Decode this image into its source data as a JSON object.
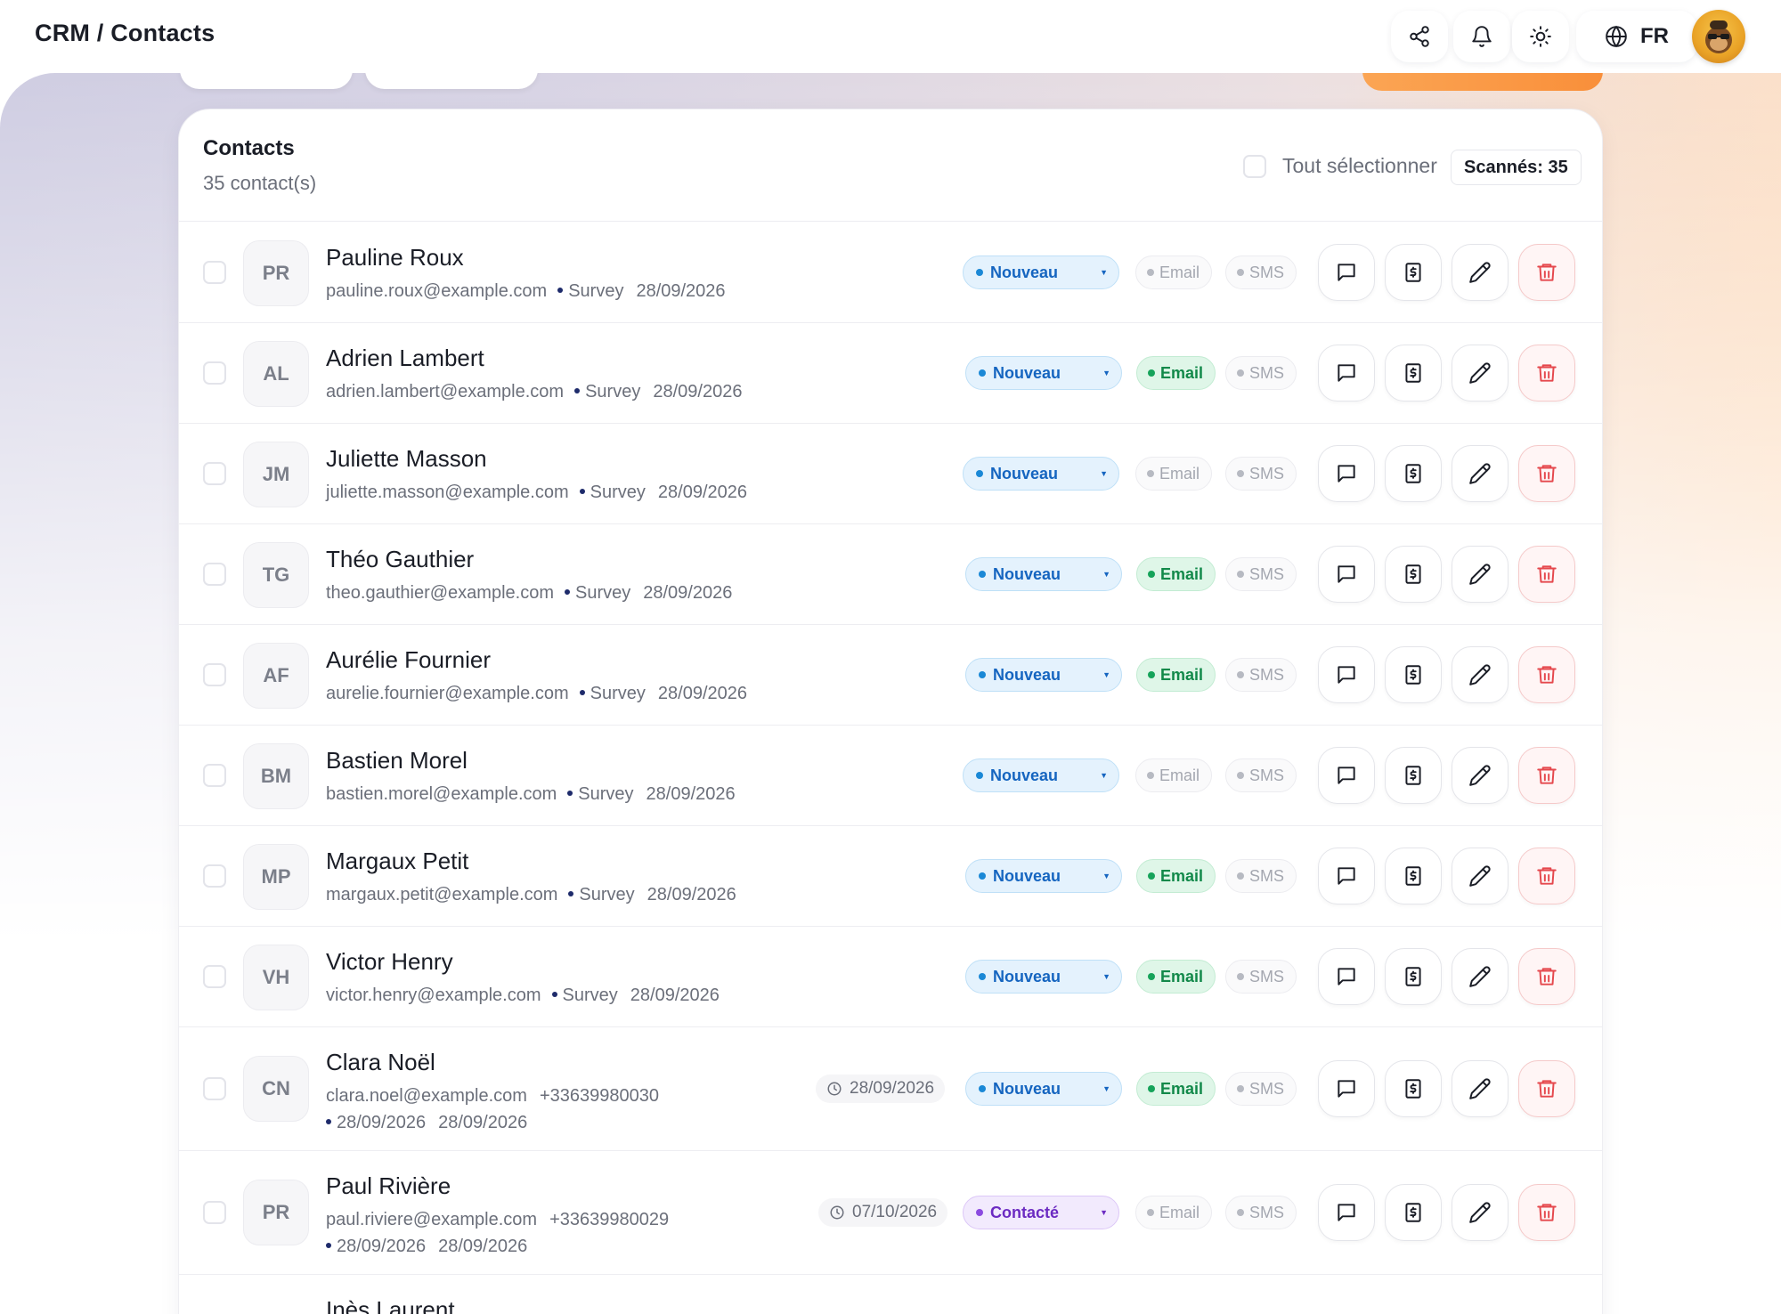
{
  "header": {
    "breadcrumb": "CRM / Contacts",
    "language": "FR",
    "icons": [
      "share-icon",
      "bell-icon",
      "sun-icon",
      "globe-icon"
    ]
  },
  "card": {
    "title": "Contacts",
    "count": "35 contact(s)",
    "select_all_label": "Tout sélectionner",
    "scanned": "Scannés: 35"
  },
  "colors": {
    "status_nouveau": "#1a88d6",
    "status_contacte": "#8b4ae0",
    "email_active": "#16a35a",
    "delete": "#e5484d"
  },
  "contacts": [
    {
      "initials": "PR",
      "name": "Pauline Roux",
      "email": "pauline.roux@example.com",
      "source": "Survey",
      "date": "28/09/2026",
      "status": "Nouveau",
      "email_label": "Email",
      "email_active": false,
      "sms_label": "SMS"
    },
    {
      "initials": "AL",
      "name": "Adrien Lambert",
      "email": "adrien.lambert@example.com",
      "source": "Survey",
      "date": "28/09/2026",
      "status": "Nouveau",
      "email_label": "Email",
      "email_active": true,
      "sms_label": "SMS"
    },
    {
      "initials": "JM",
      "name": "Juliette Masson",
      "email": "juliette.masson@example.com",
      "source": "Survey",
      "date": "28/09/2026",
      "status": "Nouveau",
      "email_label": "Email",
      "email_active": false,
      "sms_label": "SMS"
    },
    {
      "initials": "TG",
      "name": "Théo Gauthier",
      "email": "theo.gauthier@example.com",
      "source": "Survey",
      "date": "28/09/2026",
      "status": "Nouveau",
      "email_label": "Email",
      "email_active": true,
      "sms_label": "SMS"
    },
    {
      "initials": "AF",
      "name": "Aurélie Fournier",
      "email": "aurelie.fournier@example.com",
      "source": "Survey",
      "date": "28/09/2026",
      "status": "Nouveau",
      "email_label": "Email",
      "email_active": true,
      "sms_label": "SMS"
    },
    {
      "initials": "BM",
      "name": "Bastien Morel",
      "email": "bastien.morel@example.com",
      "source": "Survey",
      "date": "28/09/2026",
      "status": "Nouveau",
      "email_label": "Email",
      "email_active": false,
      "sms_label": "SMS"
    },
    {
      "initials": "MP",
      "name": "Margaux Petit",
      "email": "margaux.petit@example.com",
      "source": "Survey",
      "date": "28/09/2026",
      "status": "Nouveau",
      "email_label": "Email",
      "email_active": true,
      "sms_label": "SMS"
    },
    {
      "initials": "VH",
      "name": "Victor Henry",
      "email": "victor.henry@example.com",
      "source": "Survey",
      "date": "28/09/2026",
      "status": "Nouveau",
      "email_label": "Email",
      "email_active": true,
      "sms_label": "SMS"
    },
    {
      "initials": "CN",
      "name": "Clara Noël",
      "email": "clara.noel@example.com",
      "phone": "+33639980030",
      "date_a": "28/09/2026",
      "date_b": "28/09/2026",
      "followup": "28/09/2026",
      "status": "Nouveau",
      "email_label": "Email",
      "email_active": true,
      "sms_label": "SMS"
    },
    {
      "initials": "PR",
      "name": "Paul Rivière",
      "email": "paul.riviere@example.com",
      "phone": "+33639980029",
      "date_a": "28/09/2026",
      "date_b": "28/09/2026",
      "followup": "07/10/2026",
      "status": "Contacté",
      "email_label": "Email",
      "email_active": false,
      "sms_label": "SMS"
    },
    {
      "name": "Inès Laurent"
    }
  ]
}
